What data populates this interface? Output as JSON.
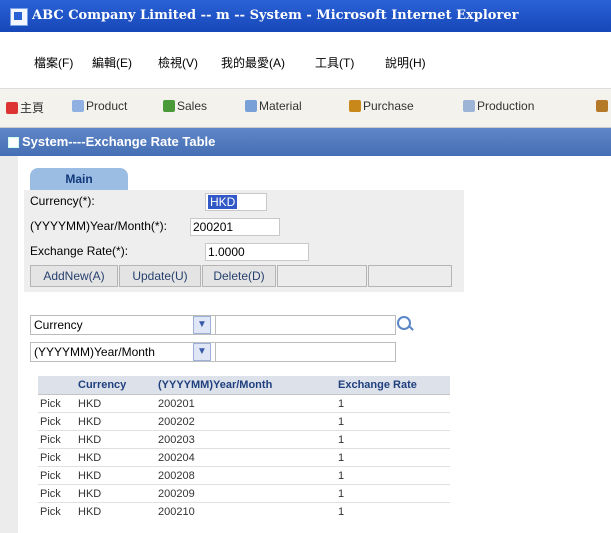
{
  "window": {
    "title": "ABC Company Limited -- m -- System - Microsoft Internet Explorer"
  },
  "menu": [
    "檔案(F)",
    "編輯(E)",
    "檢視(V)",
    "我的最愛(A)",
    "工具(T)",
    "說明(H)"
  ],
  "toolbar": {
    "items": [
      {
        "label": "主頁",
        "icon": "home-icon"
      },
      {
        "label": "Product",
        "icon": "product-icon"
      },
      {
        "label": "Sales",
        "icon": "sales-icon"
      },
      {
        "label": "Material",
        "icon": "material-icon"
      },
      {
        "label": "Purchase",
        "icon": "purchase-icon"
      },
      {
        "label": "Production",
        "icon": "production-icon"
      }
    ]
  },
  "section": {
    "title": "System----Exchange Rate Table"
  },
  "tab": {
    "label": "Main"
  },
  "form": {
    "currency_label": "Currency(*):",
    "currency_value": "HKD",
    "yearmonth_label": "(YYYYMM)Year/Month(*):",
    "yearmonth_value": "200201",
    "rate_label": "Exchange Rate(*):",
    "rate_value": "1.0000"
  },
  "buttons": {
    "addnew": "AddNew(A)",
    "update": "Update(U)",
    "delete": "Delete(D)"
  },
  "search": {
    "field1": "Currency",
    "field2": "(YYYYMM)Year/Month"
  },
  "grid": {
    "headers": [
      "",
      "Currency",
      "(YYYYMM)Year/Month",
      "Exchange Rate"
    ],
    "rows": [
      {
        "pick": "Pick",
        "currency": "HKD",
        "ym": "200201",
        "rate": "1"
      },
      {
        "pick": "Pick",
        "currency": "HKD",
        "ym": "200202",
        "rate": "1"
      },
      {
        "pick": "Pick",
        "currency": "HKD",
        "ym": "200203",
        "rate": "1"
      },
      {
        "pick": "Pick",
        "currency": "HKD",
        "ym": "200204",
        "rate": "1"
      },
      {
        "pick": "Pick",
        "currency": "HKD",
        "ym": "200208",
        "rate": "1"
      },
      {
        "pick": "Pick",
        "currency": "HKD",
        "ym": "200209",
        "rate": "1"
      },
      {
        "pick": "Pick",
        "currency": "HKD",
        "ym": "200210",
        "rate": "1"
      }
    ]
  }
}
